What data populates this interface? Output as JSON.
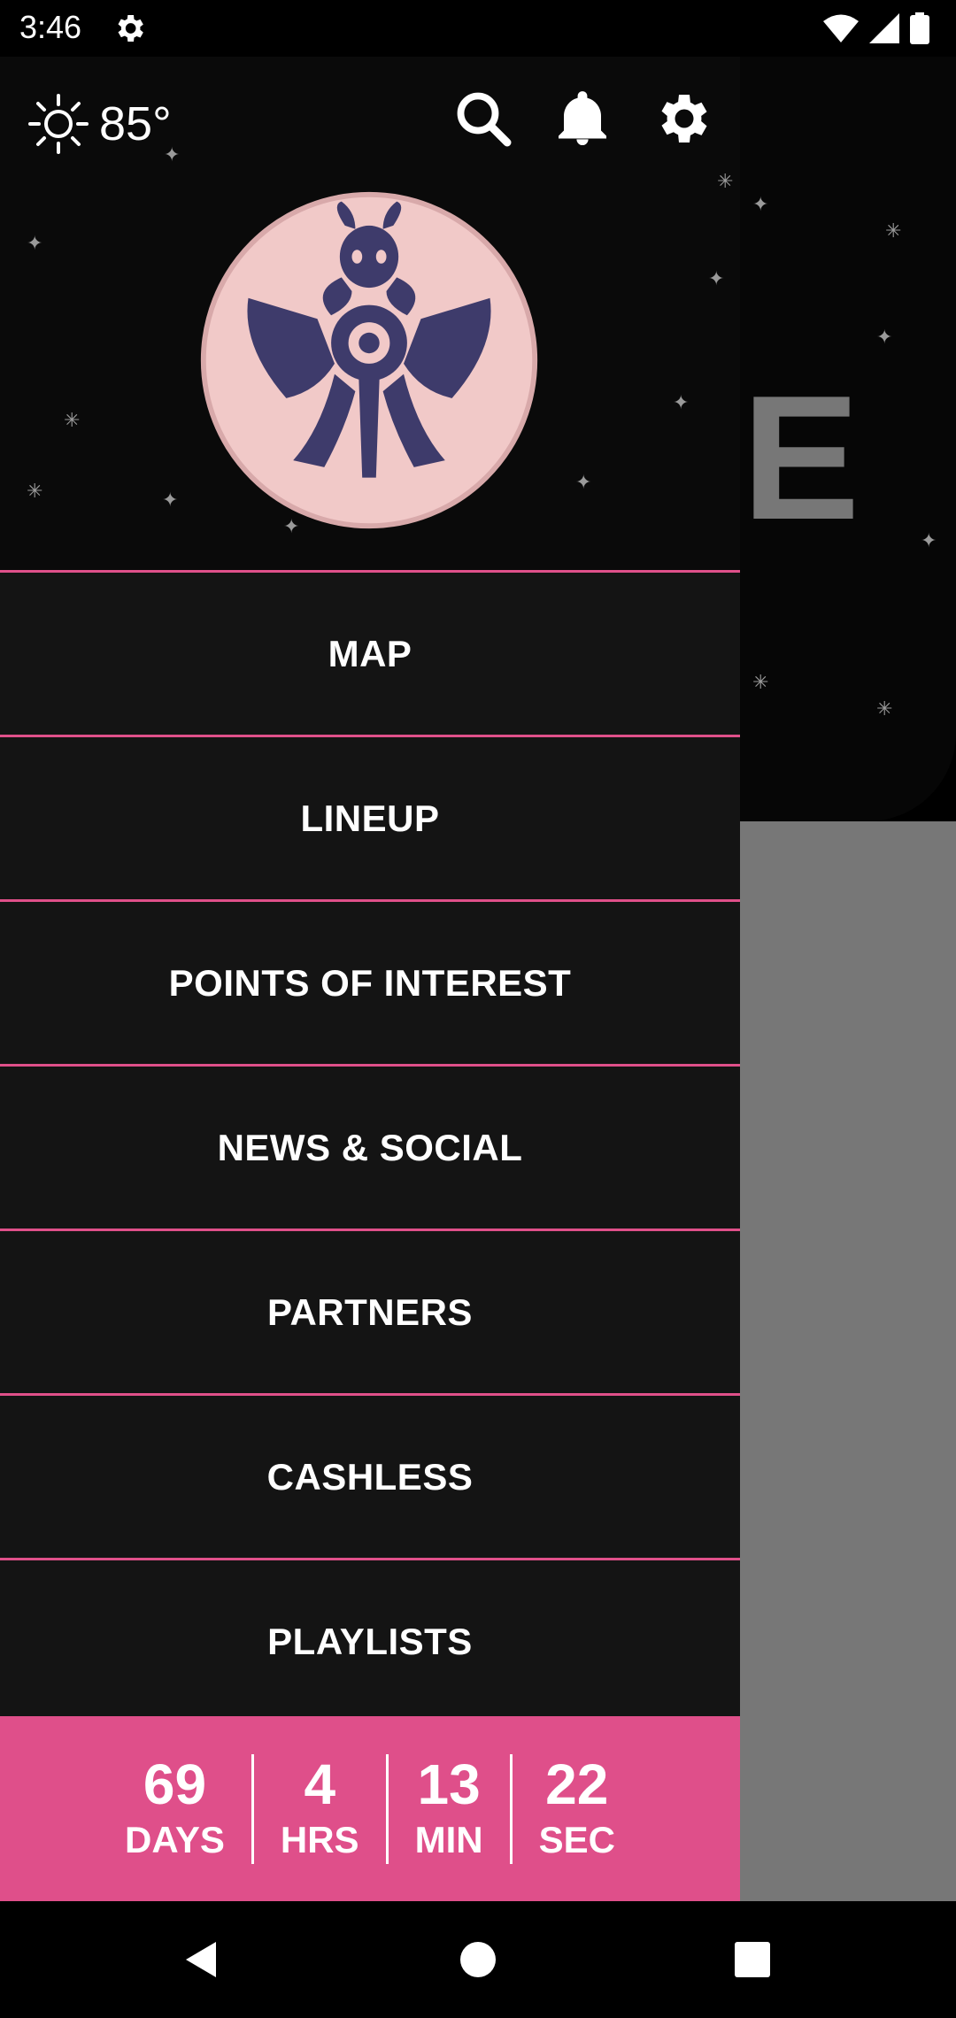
{
  "status_bar": {
    "time": "3:46"
  },
  "background": {
    "partial_letter": "E"
  },
  "drawer": {
    "weather": {
      "icon": "sun-icon",
      "temperature": "85°"
    },
    "header_icons": [
      "search-icon",
      "bell-icon",
      "gear-icon"
    ],
    "menu": [
      {
        "label": "MAP"
      },
      {
        "label": "LINEUP"
      },
      {
        "label": "POINTS OF INTEREST"
      },
      {
        "label": "NEWS & SOCIAL"
      },
      {
        "label": "PARTNERS"
      },
      {
        "label": "CASHLESS"
      },
      {
        "label": "PLAYLISTS"
      }
    ],
    "countdown": {
      "days": {
        "value": "69",
        "label": "DAYS"
      },
      "hours": {
        "value": "4",
        "label": "HRS"
      },
      "minutes": {
        "value": "13",
        "label": "MIN"
      },
      "seconds": {
        "value": "22",
        "label": "SEC"
      }
    }
  },
  "colors": {
    "accent": "#df4f8a",
    "drawer_bg": "#141414",
    "logo_pink": "#f1c9c8",
    "logo_navy": "#3e3b6b"
  },
  "nav_bar": [
    "back-icon",
    "home-icon",
    "recents-icon"
  ]
}
